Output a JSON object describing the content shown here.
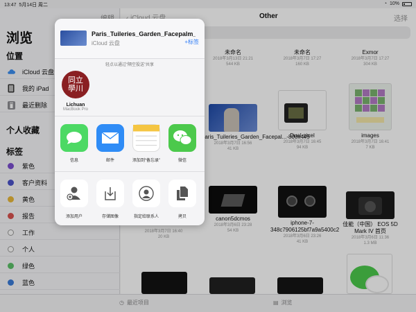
{
  "status": {
    "time": "13:47",
    "date": "5月14日 周二",
    "battery": "10%"
  },
  "sidebar": {
    "edit": "编辑",
    "title": "浏览",
    "locations_header": "位置",
    "locations": [
      {
        "label": "iCloud 云盘",
        "icon": "cloud-icon"
      },
      {
        "label": "我的 iPad",
        "icon": "ipad-icon"
      },
      {
        "label": "最近删除",
        "icon": "trash-icon"
      }
    ],
    "favorites_header": "个人收藏",
    "tags_header": "标签",
    "tags": [
      {
        "label": "紫色",
        "color": "#7b4fd0"
      },
      {
        "label": "客户资料",
        "color": "#4b52c9"
      },
      {
        "label": "黄色",
        "color": "#e8b83a"
      },
      {
        "label": "报告",
        "color": "#d9534f"
      },
      {
        "label": "工作",
        "color": ""
      },
      {
        "label": "个人",
        "color": ""
      },
      {
        "label": "绿色",
        "color": "#5cc068"
      },
      {
        "label": "蓝色",
        "color": "#3a7bd8"
      }
    ]
  },
  "main": {
    "back": "iCloud 云盘",
    "title": "Other",
    "select": "选择",
    "files": [
      {
        "name": "未命名",
        "date": "2018年3月13日 21:21",
        "size": "544 KB"
      },
      {
        "name": "未命名",
        "date": "2018年3月7日 17:27",
        "size": "160 KB"
      },
      {
        "name": "Exmor",
        "date": "2018年3月7日 17:27",
        "size": "304 KB"
      },
      {
        "name": "Paris_Tuileries_Garden_Facepal...-800x445",
        "date": "2018年3月7日 16:56",
        "size": "41 KB"
      },
      {
        "name": "Dual-pixel",
        "date": "2018年3月7日 16:45",
        "size": "94 KB"
      },
      {
        "name": "images",
        "date": "2018年3月7日 16:41",
        "size": "7 KB"
      },
      {
        "name": "",
        "date": "2018年3月7日 16:40",
        "size": "20 KB"
      },
      {
        "name": "canon5dcmos",
        "date": "2018年3月6日 23:28",
        "size": "54 KB"
      },
      {
        "name": "iphone-7-348c7906125bf7a9a5400c2",
        "date": "2018年3月6日 23:26",
        "size": "41 KB"
      },
      {
        "name": "佳能（中国） EOS 5D Mark IV  首页",
        "date": "2018年3月6日 11:36",
        "size": "1.3 MB"
      }
    ]
  },
  "share": {
    "file_name": "Paris_Tuileries_Garden_Facepalm_...",
    "location": "iCloud 云盘",
    "add_tag": "+标签",
    "airdrop_hint": "轻点以通过“隔空投送”共享",
    "airdrop_seal": "同立學川",
    "airdrop_name": "Lichuan",
    "airdrop_device": "MacBook Pro",
    "apps": [
      {
        "label": "信息",
        "icon": "messages-icon",
        "color": "#4cd964"
      },
      {
        "label": "邮件",
        "icon": "mail-icon",
        "color": "#2f8cf6"
      },
      {
        "label": "添加到“备忘录”",
        "icon": "notes-icon",
        "color": "#ffffff"
      },
      {
        "label": "微信",
        "icon": "wechat-icon",
        "color": "#4cc94c"
      }
    ],
    "actions": [
      {
        "label": "添加用户",
        "icon": "add-user-icon"
      },
      {
        "label": "存储图像",
        "icon": "save-image-icon"
      },
      {
        "label": "指定给联系人",
        "icon": "assign-contact-icon"
      },
      {
        "label": "拷贝",
        "icon": "copy-icon"
      }
    ]
  },
  "tabbar": {
    "recents": "最近项目",
    "browse": "浏览"
  }
}
